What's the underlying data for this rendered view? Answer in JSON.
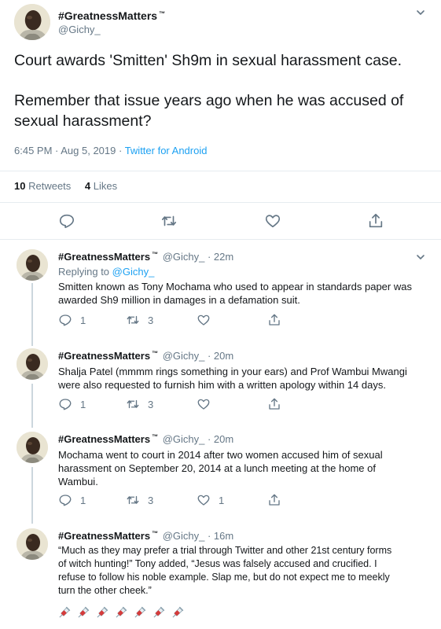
{
  "main_tweet": {
    "display_name": "#GreatnessMatters",
    "tm": "™",
    "handle": "@Gichy_",
    "text_line1": "Court awards 'Smitten' Sh9m in sexual harassment case.",
    "text_line2": "Remember that issue years ago when he was accused of",
    "text_line3": "sexual harassment?",
    "time": "6:45 PM · Aug 5, 2019 · ",
    "source": "Twitter for Android",
    "retweets_count": "10",
    "retweets_label": "Retweets",
    "likes_count": "4",
    "likes_label": "Likes"
  },
  "replies": [
    {
      "display_name": "#GreatnessMatters",
      "tm": "™",
      "meta": "@Gichy_ · 22m",
      "replying_prefix": "Replying to ",
      "replying_handle": "@Gichy_",
      "lines": [
        "Smitten known as Tony Mochama who used to appear in standards paper was",
        "awarded Sh9 million in damages in a defamation suit."
      ],
      "replies_count": "1",
      "retweets_count": "3",
      "likes_count": ""
    },
    {
      "display_name": "#GreatnessMatters",
      "tm": "™",
      "meta": "@Gichy_ · 20m",
      "lines": [
        "Shalja Patel (mmmm rings something in your ears) and Prof Wambui Mwangi",
        "were also requested to furnish him with a written apology within 14 days."
      ],
      "replies_count": "1",
      "retweets_count": "3",
      "likes_count": ""
    },
    {
      "display_name": "#GreatnessMatters",
      "tm": "™",
      "meta": "@Gichy_ · 20m",
      "lines": [
        "Mochama went to court in 2014 after two women accused him of sexual",
        "harassment on September 20, 2014 at a lunch meeting at the home of",
        "Wambui."
      ],
      "replies_count": "1",
      "retweets_count": "3",
      "likes_count": "1"
    },
    {
      "display_name": "#GreatnessMatters",
      "tm": "™",
      "meta": "@Gichy_ · 16m",
      "lines": [
        "“Much as they may prefer a trial through Twitter and other 21st century forms",
        "of witch hunting!” Tony added, “Jesus was falsely accused and crucified. I",
        "refuse to follow his noble example. Slap me, but do not expect me to meekly",
        "turn the other cheek.”"
      ],
      "emoji_row": "💉💉💉💉💉💉💉"
    }
  ],
  "colors": {
    "link": "#1da1f2",
    "muted": "#657786",
    "text": "#14171a",
    "divider": "#e6ecf0"
  }
}
